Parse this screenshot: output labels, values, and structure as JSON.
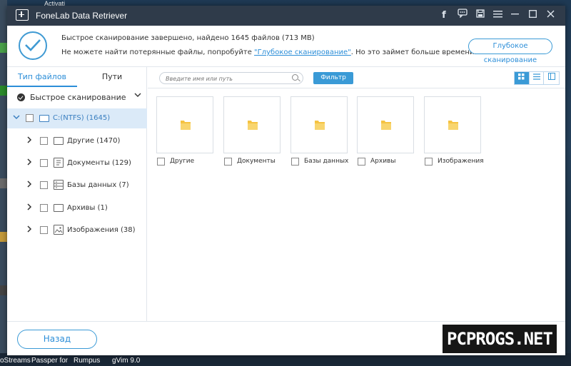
{
  "window": {
    "title": "FoneLab Data Retriever",
    "titlebar_icons": [
      "facebook-icon",
      "chat-icon",
      "save-icon",
      "menu-icon",
      "minimize-icon",
      "maximize-icon",
      "close-icon"
    ]
  },
  "header": {
    "line1": "Быстрое сканирование завершено, найдено 1645 файлов (713 MB)",
    "line2_prefix": "Не можете найти потерянные файлы, попробуйте ",
    "line2_link": "\"Глубокое сканирование\"",
    "line2_suffix": ". Но это займет больше времени.",
    "deep_scan_button": "Глубокое сканирование"
  },
  "left_panel": {
    "tabs": [
      {
        "label": "Тип файлов",
        "active": true
      },
      {
        "label": "Пути",
        "active": false
      }
    ],
    "scan_mode": "Быстрое сканирование",
    "tree": [
      {
        "label": "C:(NTFS) (1645)",
        "icon": "drive-icon",
        "expanded": true,
        "selected": true
      },
      {
        "label": "Другие (1470)",
        "icon": "folder-icon"
      },
      {
        "label": "Документы (129)",
        "icon": "document-icon"
      },
      {
        "label": "Базы данных (7)",
        "icon": "database-icon"
      },
      {
        "label": "Архивы (1)",
        "icon": "archive-icon"
      },
      {
        "label": "Изображения (38)",
        "icon": "image-icon"
      }
    ]
  },
  "toolbar": {
    "search_placeholder": "Введите имя или путь",
    "filter_button": "Фильтр",
    "views": [
      "grid-view-icon",
      "list-view-icon",
      "detail-view-icon"
    ],
    "active_view": "grid-view-icon"
  },
  "grid": {
    "items": [
      {
        "label": "Другие"
      },
      {
        "label": "Документы"
      },
      {
        "label": "Базы данных"
      },
      {
        "label": "Архивы"
      },
      {
        "label": "Изображения"
      }
    ]
  },
  "footer": {
    "back_button": "Назад"
  },
  "desktop": {
    "top_fragment": "Activati",
    "taskbar_labels": [
      "oStreams",
      "Passper for",
      "Rumpus",
      "gVim 9.0"
    ],
    "watermark": "PCPROGS.NET"
  },
  "colors": {
    "accent": "#2c8ed8",
    "titlebar": "#2f3b4a",
    "selection": "#dbeaf8",
    "folder": "#f5c342"
  }
}
